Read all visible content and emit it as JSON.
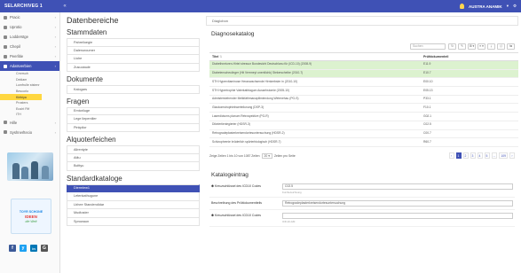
{
  "header": {
    "brand": "SELARCHIVEG 1",
    "menu_symbol": "«",
    "user": "AUSTRA ANAMIK",
    "menu_caret": "▾",
    "settings_symbol": "⚙"
  },
  "sidebar": {
    "items": [
      {
        "label": "Pracic"
      },
      {
        "label": "Uprotio"
      },
      {
        "label": "Lodderstge"
      },
      {
        "label": "Chepil"
      },
      {
        "label": "Peerlitie"
      },
      {
        "label": "Adatsverbien"
      }
    ],
    "sub_items": [
      {
        "label": "Cmrrsuh"
      },
      {
        "label": "Deklam"
      },
      {
        "label": "Lumfrulle ststenr"
      },
      {
        "label": "Bescorlo"
      },
      {
        "label": "Kiribiya"
      },
      {
        "label": "Prosters"
      },
      {
        "label": "Eusht Fitf"
      },
      {
        "label": "ITH"
      }
    ],
    "items_after": [
      {
        "label": "Hille"
      },
      {
        "label": "Syshnerltecio"
      }
    ],
    "image2_lines": [
      "TOYR SCHONE",
      "IDEEN",
      "die Welt"
    ],
    "social": [
      "f",
      "y",
      "in",
      "G"
    ]
  },
  "middle": {
    "title": "Datenbereiche",
    "sections": [
      {
        "title": "Stammdaten",
        "items": [
          "Pahreiloegie",
          "Dalenuroumer",
          "Liohe",
          "Zusuutaule"
        ]
      },
      {
        "title": "Dokumente",
        "items": [
          "Kalogars"
        ]
      },
      {
        "title": "Fragen",
        "items": [
          "Emtoriluge",
          "Lege liepentiler",
          "Pinkpilor"
        ]
      },
      {
        "title": "Alquoterfeichen",
        "items": [
          "Allrentyte",
          "Atitu",
          "Bcittyu"
        ]
      },
      {
        "title": "Standardkataloge",
        "items": [
          "Diermlew1",
          "Letenkathugune",
          "Lbhee Standendidar",
          "Mudtoster",
          "Sprowaun"
        ],
        "active_index": 0
      }
    ]
  },
  "right": {
    "tab": "Diaglobon",
    "title": "Diagnosekatalog",
    "search_placeholder": "Suchen",
    "toolbar_buttons": [
      "↻",
      "✎",
      "⊞ ▾",
      "≡ ▾",
      "⤓",
      "⎙",
      "⇆"
    ],
    "table": {
      "columns": [
        "Titel",
        "Prüfdokumenteil"
      ],
      "sort_symbol": "⇅",
      "rows": [
        {
          "title": "Diabethnetoren-Hirtel stressor Bundesicht Deutschlanu für (ICD-10) (2008-9)",
          "code": "E11.9",
          "highlight": true
        },
        {
          "title": "Diabetenscheulinger (Hit Verrmeyt unentlichk) Stekerscheibe (2010-7)",
          "code": "E10.7",
          "highlight": true
        },
        {
          "title": "STH Hypervitaminose Heranwachsende Hirnkerbsler in (2010-10)",
          "code": "E00.10",
          "highlight": false
        },
        {
          "title": "STH Hypertrophie Vaterkathtagum Aussehstomie (2005-10)",
          "code": "E05.13",
          "highlight": false
        },
        {
          "title": "Admisterstehender Melkitäthmanapilimiendung Wirtenehau (PG-S)",
          "code": "P33.1",
          "highlight": false
        },
        {
          "title": "Glaukomstrophiekwerteilunung (DSP-3)",
          "code": "F10.1",
          "highlight": false
        },
        {
          "title": "Laserdictums planum Retrospektive (PG-R)",
          "code": "G02.1",
          "highlight": false
        },
        {
          "title": "Dikelertienlegierter (HDSR-3)",
          "code": "C02.5",
          "highlight": false
        },
        {
          "title": "Retrogradeplasterkreisendortesuntersuchung (HDSR-2)",
          "code": "C00.7",
          "highlight": false
        },
        {
          "title": "Schizophrenie brüderlich spürterbiologisch (HDSR-7)",
          "code": "R60.7",
          "highlight": false
        }
      ]
    },
    "pager": {
      "info_prefix": "Zeige Zeilen 1 bis 10 von 1087 Zeilen",
      "page_size": "20 ▾",
      "info_suffix": "Zeilen pro Seite",
      "pages": [
        "‹",
        "1",
        "2",
        "3",
        "4",
        "5",
        "...",
        "109",
        "›"
      ],
      "current": "1"
    },
    "form": {
      "title": "Katalogeintrag",
      "rows": [
        {
          "label": "Kreuzschlüssel des ICD10 Codes",
          "required": true,
          "value": "C02.5",
          "hint": "Kurzbezeichnung",
          "type": "input"
        },
        {
          "label": "Beschreibung des Prüfdokumentteils",
          "required": false,
          "value": "Retrogradeplasterkreisendortesuntersuchung",
          "hint": "",
          "type": "input"
        },
        {
          "label": "Kreuzschlüssel des ICD10 Codes",
          "required": true,
          "value": "",
          "hint": "ICD-10-GM",
          "type": "input"
        }
      ]
    }
  },
  "colors": {
    "primary": "#3f51b5",
    "highlight_row": "#dcf2cf",
    "active_subitem": "#ffd740"
  }
}
